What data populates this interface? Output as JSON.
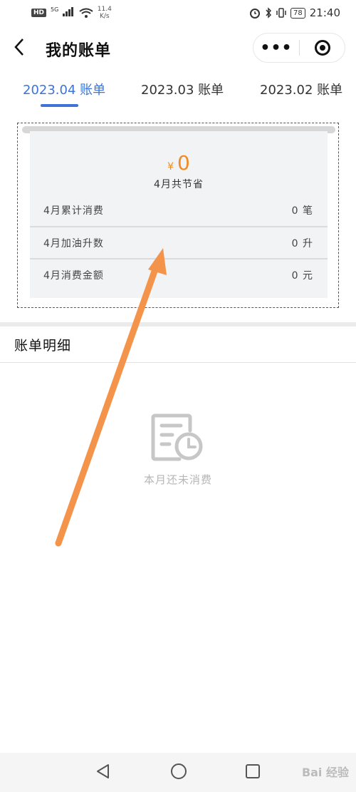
{
  "status_bar": {
    "network_badge": "HD",
    "signal_label": "5G",
    "speed_value": "11.4",
    "speed_unit": "K/s",
    "battery": "78",
    "time": "21:40"
  },
  "nav": {
    "title": "我的账单",
    "more_label": "•••"
  },
  "tabs": [
    {
      "label": "2023.04 账单",
      "active": true
    },
    {
      "label": "2023.03 账单",
      "active": false
    },
    {
      "label": "2023.02 账单",
      "active": false
    }
  ],
  "summary": {
    "currency_symbol": "¥",
    "saved_amount": "0",
    "saved_label": "4月共节省",
    "rows": [
      {
        "label": "4月累计消费",
        "value": "0 笔"
      },
      {
        "label": "4月加油升数",
        "value": "0 升"
      },
      {
        "label": "4月消费金额",
        "value": "0 元"
      }
    ]
  },
  "details": {
    "section_title": "账单明细",
    "empty_text": "本月还未消费"
  },
  "watermark": "Bai 经验",
  "colors": {
    "accent": "#3d74d6",
    "amount": "#f08c25",
    "annotation_arrow": "#f4944a"
  }
}
